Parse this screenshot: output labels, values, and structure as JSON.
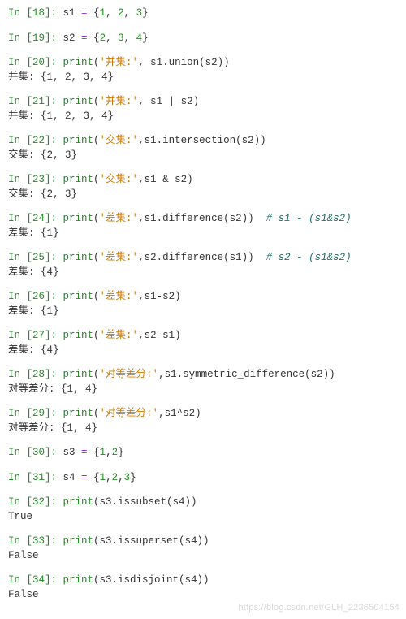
{
  "watermark": "https://blog.csdn.net/GLH_2236504154",
  "cells": [
    {
      "prompt": "In [18]: ",
      "code": [
        [
          "plain",
          "s1 "
        ],
        [
          "op",
          "="
        ],
        [
          "plain",
          " {"
        ],
        [
          "num",
          "1"
        ],
        [
          "plain",
          ", "
        ],
        [
          "num",
          "2"
        ],
        [
          "plain",
          ", "
        ],
        [
          "num",
          "3"
        ],
        [
          "plain",
          "}"
        ]
      ],
      "output": null
    },
    {
      "prompt": "In [19]: ",
      "code": [
        [
          "plain",
          "s2 "
        ],
        [
          "op",
          "="
        ],
        [
          "plain",
          " {"
        ],
        [
          "num",
          "2"
        ],
        [
          "plain",
          ", "
        ],
        [
          "num",
          "3"
        ],
        [
          "plain",
          ", "
        ],
        [
          "num",
          "4"
        ],
        [
          "plain",
          "}"
        ]
      ],
      "output": null
    },
    {
      "prompt": "In [20]: ",
      "code": [
        [
          "kw",
          "print"
        ],
        [
          "plain",
          "("
        ],
        [
          "str",
          "'并集:'"
        ],
        [
          "plain",
          ", s1.union(s2))"
        ]
      ],
      "output": "并集: {1, 2, 3, 4}"
    },
    {
      "prompt": "In [21]: ",
      "code": [
        [
          "kw",
          "print"
        ],
        [
          "plain",
          "("
        ],
        [
          "str",
          "'并集:'"
        ],
        [
          "plain",
          ", s1 | s2)"
        ]
      ],
      "output": "并集: {1, 2, 3, 4}"
    },
    {
      "prompt": "In [22]: ",
      "code": [
        [
          "kw",
          "print"
        ],
        [
          "plain",
          "("
        ],
        [
          "str",
          "'交集:'"
        ],
        [
          "plain",
          ",s1.intersection(s2))"
        ]
      ],
      "output": "交集: {2, 3}"
    },
    {
      "prompt": "In [23]: ",
      "code": [
        [
          "kw",
          "print"
        ],
        [
          "plain",
          "("
        ],
        [
          "str",
          "'交集:'"
        ],
        [
          "plain",
          ",s1 & s2)"
        ]
      ],
      "output": "交集: {2, 3}"
    },
    {
      "prompt": "In [24]: ",
      "code": [
        [
          "kw",
          "print"
        ],
        [
          "plain",
          "("
        ],
        [
          "str",
          "'差集:'"
        ],
        [
          "plain",
          ",s1.difference(s2))  "
        ],
        [
          "cmt",
          "# s1 - (s1&s2)"
        ]
      ],
      "output": "差集: {1}"
    },
    {
      "prompt": "In [25]: ",
      "code": [
        [
          "kw",
          "print"
        ],
        [
          "plain",
          "("
        ],
        [
          "str",
          "'差集:'"
        ],
        [
          "plain",
          ",s2.difference(s1))  "
        ],
        [
          "cmt",
          "# s2 - (s1&s2)"
        ]
      ],
      "output": "差集: {4}"
    },
    {
      "prompt": "In [26]: ",
      "code": [
        [
          "kw",
          "print"
        ],
        [
          "plain",
          "("
        ],
        [
          "str",
          "'差集:'"
        ],
        [
          "plain",
          ",s1-s2)"
        ]
      ],
      "output": "差集: {1}"
    },
    {
      "prompt": "In [27]: ",
      "code": [
        [
          "kw",
          "print"
        ],
        [
          "plain",
          "("
        ],
        [
          "str",
          "'差集:'"
        ],
        [
          "plain",
          ",s2-s1)"
        ]
      ],
      "output": "差集: {4}"
    },
    {
      "prompt": "In [28]: ",
      "code": [
        [
          "kw",
          "print"
        ],
        [
          "plain",
          "("
        ],
        [
          "str",
          "'对等差分:'"
        ],
        [
          "plain",
          ",s1.symmetric_difference(s2))"
        ]
      ],
      "output": "对等差分: {1, 4}"
    },
    {
      "prompt": "In [29]: ",
      "code": [
        [
          "kw",
          "print"
        ],
        [
          "plain",
          "("
        ],
        [
          "str",
          "'对等差分:'"
        ],
        [
          "plain",
          ",s1^s2)"
        ]
      ],
      "output": "对等差分: {1, 4}"
    },
    {
      "prompt": "In [30]: ",
      "code": [
        [
          "plain",
          "s3 "
        ],
        [
          "op",
          "="
        ],
        [
          "plain",
          " {"
        ],
        [
          "num",
          "1"
        ],
        [
          "plain",
          ","
        ],
        [
          "num",
          "2"
        ],
        [
          "plain",
          "}"
        ]
      ],
      "output": null
    },
    {
      "prompt": "In [31]: ",
      "code": [
        [
          "plain",
          "s4 "
        ],
        [
          "op",
          "="
        ],
        [
          "plain",
          " {"
        ],
        [
          "num",
          "1"
        ],
        [
          "plain",
          ","
        ],
        [
          "num",
          "2"
        ],
        [
          "plain",
          ","
        ],
        [
          "num",
          "3"
        ],
        [
          "plain",
          "}"
        ]
      ],
      "output": null
    },
    {
      "prompt": "In [32]: ",
      "code": [
        [
          "kw",
          "print"
        ],
        [
          "plain",
          "(s3.issubset(s4))"
        ]
      ],
      "output": "True"
    },
    {
      "prompt": "In [33]: ",
      "code": [
        [
          "kw",
          "print"
        ],
        [
          "plain",
          "(s3.issuperset(s4))"
        ]
      ],
      "output": "False"
    },
    {
      "prompt": "In [34]: ",
      "code": [
        [
          "kw",
          "print"
        ],
        [
          "plain",
          "(s3.isdisjoint(s4))"
        ]
      ],
      "output": "False"
    }
  ]
}
